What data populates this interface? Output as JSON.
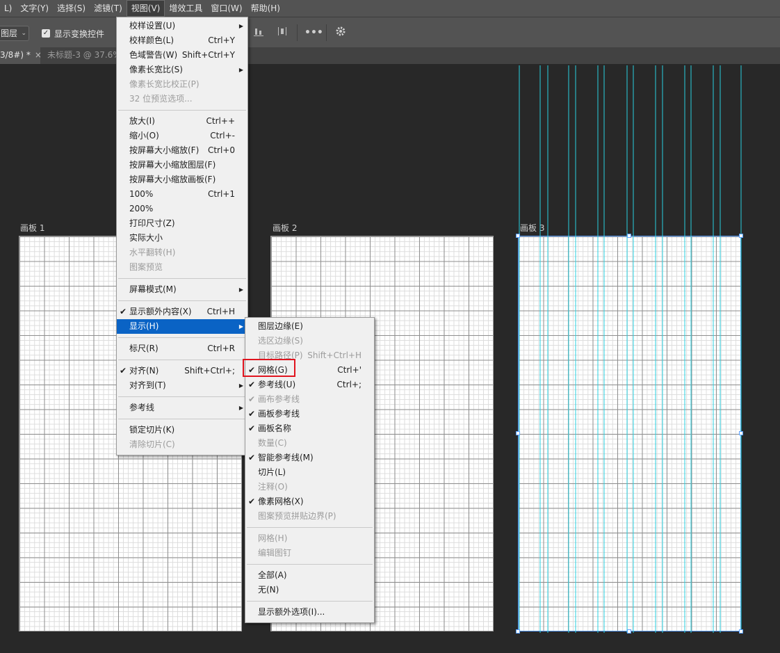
{
  "menubar": [
    {
      "label": "L)"
    },
    {
      "label": "文字(Y)"
    },
    {
      "label": "选择(S)"
    },
    {
      "label": "滤镜(T)"
    },
    {
      "label": "视图(V)",
      "active": true
    },
    {
      "label": "增效工具"
    },
    {
      "label": "窗口(W)"
    },
    {
      "label": "帮助(H)"
    }
  ],
  "options_bar": {
    "layer_select": "图层",
    "show_transform_label": "显示变换控件",
    "show_transform_checked": true,
    "icons": [
      "align-bottom-icon",
      "distribute-icon",
      "more-icon",
      "gear-icon"
    ]
  },
  "tabs": {
    "active": "3/8#) *",
    "inactive": "未标题-3 @ 37.6%"
  },
  "artboards": [
    {
      "label": "画板 1"
    },
    {
      "label": "画板 2"
    },
    {
      "label": "画板 3"
    }
  ],
  "view_menu": [
    {
      "label": "校样设置(U)",
      "submenu": true
    },
    {
      "label": "校样颜色(L)",
      "shortcut": "Ctrl+Y"
    },
    {
      "label": "色域警告(W)",
      "shortcut": "Shift+Ctrl+Y"
    },
    {
      "label": "像素长宽比(S)",
      "submenu": true
    },
    {
      "label": "像素长宽比校正(P)",
      "disabled": true
    },
    {
      "label": "32 位预览选项...",
      "disabled": true
    },
    {
      "sep": true
    },
    {
      "label": "放大(I)",
      "shortcut": "Ctrl++"
    },
    {
      "label": "缩小(O)",
      "shortcut": "Ctrl+-"
    },
    {
      "label": "按屏幕大小缩放(F)",
      "shortcut": "Ctrl+0"
    },
    {
      "label": "按屏幕大小缩放图层(F)"
    },
    {
      "label": "按屏幕大小缩放画板(F)"
    },
    {
      "label": "100%",
      "shortcut": "Ctrl+1"
    },
    {
      "label": "200%"
    },
    {
      "label": "打印尺寸(Z)"
    },
    {
      "label": "实际大小"
    },
    {
      "label": "水平翻转(H)",
      "disabled": true
    },
    {
      "label": "图案预览",
      "disabled": true
    },
    {
      "sep": true
    },
    {
      "label": "屏幕模式(M)",
      "submenu": true
    },
    {
      "sep": true
    },
    {
      "label": "显示额外内容(X)",
      "shortcut": "Ctrl+H",
      "checked": true
    },
    {
      "label": "显示(H)",
      "submenu": true,
      "highlighted": true
    },
    {
      "sep": true
    },
    {
      "label": "标尺(R)",
      "shortcut": "Ctrl+R"
    },
    {
      "sep": true
    },
    {
      "label": "对齐(N)",
      "shortcut": "Shift+Ctrl+;",
      "checked": true
    },
    {
      "label": "对齐到(T)",
      "submenu": true
    },
    {
      "sep": true
    },
    {
      "label": "参考线",
      "submenu": true
    },
    {
      "sep": true
    },
    {
      "label": "锁定切片(K)"
    },
    {
      "label": "清除切片(C)",
      "disabled": true
    }
  ],
  "show_submenu": [
    {
      "label": "图层边缘(E)"
    },
    {
      "label": "选区边缘(S)",
      "disabled": true
    },
    {
      "label": "目标路径(P)",
      "shortcut": "Shift+Ctrl+H",
      "disabled": true
    },
    {
      "label": "网格(G)",
      "shortcut": "Ctrl+'",
      "checked": true,
      "boxed": true
    },
    {
      "label": "参考线(U)",
      "shortcut": "Ctrl+;",
      "checked": true
    },
    {
      "label": "画布参考线",
      "checked": true,
      "disabled": true
    },
    {
      "label": "画板参考线",
      "checked": true
    },
    {
      "label": "画板名称",
      "checked": true
    },
    {
      "label": "数量(C)",
      "disabled": true
    },
    {
      "label": "智能参考线(M)",
      "checked": true
    },
    {
      "label": "切片(L)"
    },
    {
      "label": "注释(O)",
      "disabled": true
    },
    {
      "label": "像素网格(X)",
      "checked": true
    },
    {
      "label": "图案预览拼贴边界(P)",
      "disabled": true
    },
    {
      "sep": true
    },
    {
      "label": "网格(H)",
      "disabled": true
    },
    {
      "label": "编辑图钉",
      "disabled": true
    },
    {
      "sep": true
    },
    {
      "label": "全部(A)"
    },
    {
      "label": "无(N)"
    },
    {
      "sep": true
    },
    {
      "label": "显示额外选项(I)..."
    }
  ],
  "colors": {
    "highlight": "#0a63c5",
    "annotation_box": "#e0141e",
    "guide": "#29d0e0"
  }
}
